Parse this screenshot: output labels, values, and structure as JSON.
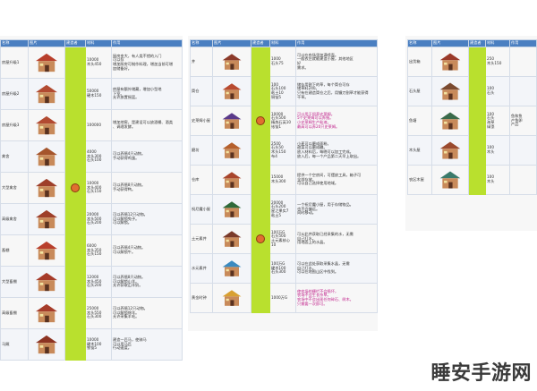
{
  "headers": {
    "name": "名称",
    "image": "图片",
    "req": "建造者",
    "mat": "材料",
    "effect": "作用"
  },
  "table1": {
    "rows": [
      {
        "name": "房屋升级1",
        "mat": "10000\n木头450",
        "effect": "厨房变大，有人类不错的入门\n可以存\n增加厨房可制作料理，增加当前可增\n加储备好。",
        "color": "#b83f2c"
      },
      {
        "name": "房屋升级2",
        "mat": "50000\n硬木150",
        "effect": "房屋有额外储藏，增加小型地\n下室。\n允许放置摇篮。",
        "color": "#b24a31"
      },
      {
        "name": "房屋升级3",
        "mat": "100000",
        "effect": "增加地窖，是建设可以放酒桶、酒类\n、调理发酵。",
        "color": "#b24a31"
      },
      {
        "name": "禽舍",
        "mat": "4000\n木头300\n石头100",
        "effect": "可以养殖4只动物。\n手动获得鸡蛋。",
        "color": "#a5552c"
      },
      {
        "name": "大型禽舍",
        "mat": "10000\n木头400\n石头150",
        "effect": "可以养殖8只动物。\n手动获得鸭。",
        "color": "#9e3f2a"
      },
      {
        "name": "高级禽舍",
        "mat": "20000\n木头500\n石头200",
        "effect": "可以养殖12只动物。\n可以解锁兔子。\n可以解锁。",
        "color": "#9e3f2a"
      },
      {
        "name": "畜棚",
        "mat": "6000\n木头350\n石头150",
        "effect": "可以养殖4只动物。\n可以解锁牛。",
        "color": "#b83f2c"
      },
      {
        "name": "大型畜棚",
        "mat": "12000\n木头450\n石头200",
        "effect": "可以养殖8只动物。\n可以解锁山羊。\n允许获取山羊奶。",
        "color": "#a63c2a"
      },
      {
        "name": "高级畜棚",
        "mat": "25000\n木头550\n石头300",
        "effect": "可以养殖12只动物。\n可以解锁绵羊。\n允许采集羊毛。",
        "color": "#a63c2a"
      },
      {
        "name": "马厩",
        "mat": "10000\n硬木100\n铁锭5",
        "effect": "建造一匹马，使骑马\n可以用马匹\n行动速度。",
        "color": "#8c3322"
      }
    ]
  },
  "table2": {
    "rows": [
      {
        "name": "井",
        "mat": "1000\n石头75",
        "effect": "可以在农场里加满喷壶。\n一般农庄就能建造小屋，其他地区\n好\n需求。",
        "color": "#8c3a2a",
        "red": false
      },
      {
        "name": "筒仓",
        "mat": "100\n石头100\n粘土10\n铜锭5",
        "effect": "储存用割下的草，每个筒仓可存\n储草料240。\n只有在建造筒仓之后，用镰刀割草才能获得\n干草。",
        "color": "#b84a30",
        "red": false
      },
      {
        "name": "史莱姆小屋",
        "mat": "10000\n石头500\n精炼石英10\n铱锭1",
        "effect": "可以用于饲养史莱姆。\n5个史莱姆可以养殖。\n小史莱姆生产粘液。\n最高可以养20只史莱姆。",
        "color": "#5a3a8a",
        "red": true
      },
      {
        "name": "磨坊",
        "mat": "2500\n石头50\n木头150\n布4",
        "effect": "小麦可以磨成面粉。\n甜菜可以磨成糖。\n放入材料后，每晚可以加工完成。\n放入后，每一个产品第二天早上取出。",
        "color": "#b5602d",
        "red": false
      },
      {
        "name": "仓库",
        "mat": "15000\n木头300",
        "effect": "提供一个空房间，可摆放工具，箱子可\n全部存放。\n可以自己选择使用地域。",
        "color": "#a8452c",
        "red": false
      },
      {
        "name": "祝尼魔小屋",
        "mat": "20000\n石头200\n星之果实7\n粘土5",
        "effect": "一个祝尼魔小屋，用于存储物品。\n也不会偏远。\n同时移动。",
        "color": "#2f6a3a",
        "red": false
      },
      {
        "name": "土元素井",
        "mat": "100万G\n石头500\n土元素核心10",
        "effect": "可从此井获取已经采集的水，无需\n自己打水。\n用地面上的水晶。",
        "color": "#7a3a2a",
        "red": false
      },
      {
        "name": "水元素井",
        "mat": "100万G\n硬木100\n石头300",
        "effect": "可以在此处获取采集水晶，无需\n自己打水。\n可以在地图山区中找到。",
        "color": "#3a8ac0",
        "red": false
      },
      {
        "name": "黄金时钟",
        "mat": "1000万G",
        "effect": "使农场的栅栏不会损坏，\n农场不会生长杂草。\n农场中不会出现任何碎石、树木。\n只需要一次即可。",
        "color": "#d8a032",
        "red": true
      }
    ]
  },
  "table3": {
    "rows": [
      {
        "name": "出货箱",
        "mat": "250\n木头150",
        "effect": "",
        "color": "#9a3a2a"
      },
      {
        "name": "石头屋",
        "mat": "100\n石头",
        "effect": "",
        "color": "#7a4a30"
      },
      {
        "name": "鱼塘",
        "mat": "100\n石头\n海草\n绿藻",
        "effect": "鱼和鱼\n产鱼卵\n产品",
        "color": "#3a6a4a"
      },
      {
        "name": "木头屋",
        "mat": "100\n木头\n",
        "effect": "",
        "color": "#9a4a2e"
      },
      {
        "name": "农区木屋",
        "mat": "100\n木头\n",
        "effect": "",
        "color": "#3a7a6a"
      }
    ]
  },
  "watermark": "睡安手游网"
}
